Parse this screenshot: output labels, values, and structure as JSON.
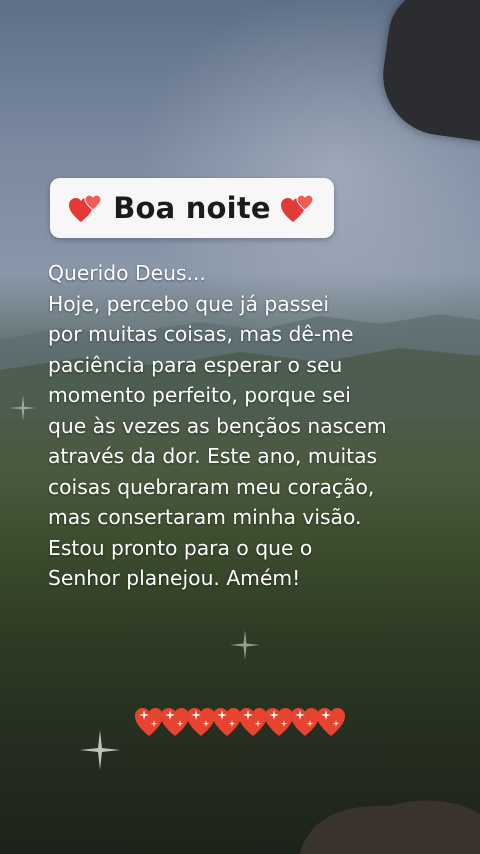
{
  "title": {
    "text": "Boa noite",
    "left_icon": "double-heart-icon",
    "right_icon": "double-heart-icon"
  },
  "message": {
    "text": "Querido Deus...\nHoje, percebo que já passei\npor muitas coisas, mas dê-me\npaciência para esperar o seu\nmomento perfeito, porque sei\nque às vezes as bençãos nascem\natravés da dor. Este ano, muitas\ncoisas quebraram meu coração,\nmas consertaram minha visão.\nEstou pronto para o que o\nSenhor planejou. Amém!"
  },
  "decoration": {
    "hearts_icon": "sparkling-heart-icon",
    "heart_color": "#e8432e",
    "sparkle_icon": "sparkle-icon"
  }
}
